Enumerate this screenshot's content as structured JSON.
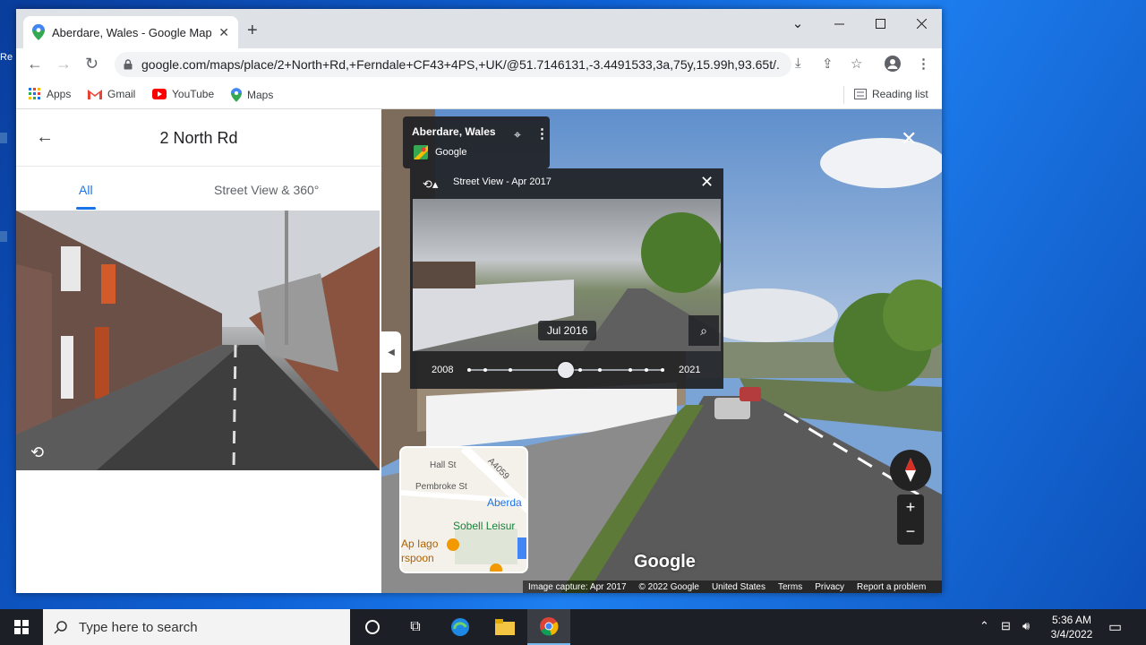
{
  "browser": {
    "tab_title": "Aberdare, Wales - Google Maps",
    "tab_close": "✕",
    "new_tab": "+",
    "url": "google.com/maps/place/2+North+Rd,+Ferndale+CF43+4PS,+UK/@51.7146131,-3.4491533,3a,75y,15.99h,93.65t/...",
    "bookmarks": [
      "Apps",
      "Gmail",
      "YouTube",
      "Maps"
    ],
    "reading_list": "Reading list"
  },
  "left_panel": {
    "title": "2 North Rd",
    "tabs": [
      "All",
      "Street View & 360°"
    ]
  },
  "street_view": {
    "location": "Aberdare, Wales",
    "provider": "Google",
    "time_travel": {
      "header": "Street View - Apr 2017",
      "thumb_date": "Jul 2016",
      "range_start": "2008",
      "range_end": "2021",
      "slider_position": 0.5
    },
    "logo": "Google",
    "footer": [
      "Image capture: Apr 2017",
      "© 2022 Google",
      "United States",
      "Terms",
      "Privacy",
      "Report a problem"
    ],
    "map_labels": [
      "Hall St",
      "A4059",
      "Pembroke St",
      "Aberda",
      "Sobell Leisur",
      "Ap Iago",
      "rspoon"
    ]
  },
  "taskbar": {
    "search_placeholder": "Type here to search",
    "time": "5:36 AM",
    "date": "3/4/2022"
  },
  "colors": {
    "accent": "#1a73e8",
    "taskbar": "#1d1f26"
  }
}
